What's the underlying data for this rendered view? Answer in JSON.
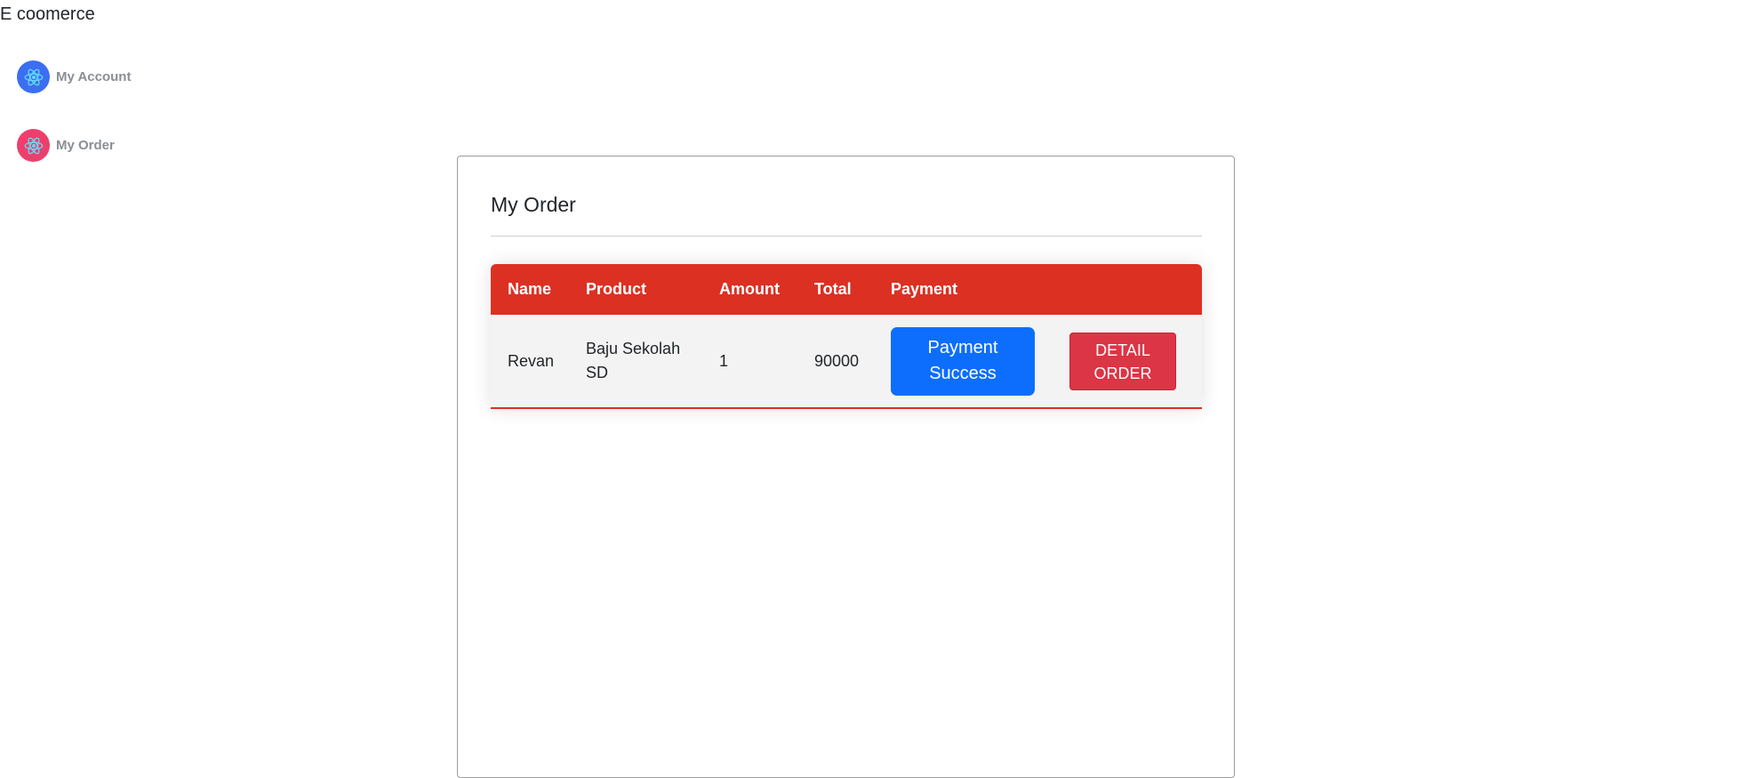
{
  "app": {
    "brand": "E coomerce"
  },
  "sidebar": {
    "items": [
      {
        "label": "My Account",
        "icon": "react-atom-icon",
        "icon_bg": "#3c6ef2"
      },
      {
        "label": "My Order",
        "icon": "react-atom-icon",
        "icon_bg": "#ee3f6c"
      }
    ]
  },
  "main": {
    "title": "My Order",
    "table": {
      "headers": [
        "Name",
        "Product",
        "Amount",
        "Total",
        "Payment"
      ],
      "rows": [
        {
          "name": "Revan",
          "product": "Baju Sekolah SD",
          "amount": "1",
          "total": "90000",
          "payment_label": "Payment Success",
          "detail_label": "DETAIL ORDER"
        }
      ]
    }
  },
  "colors": {
    "header_red": "#dc3023",
    "payment_blue": "#0d6efd",
    "detail_red": "#dc3545"
  }
}
